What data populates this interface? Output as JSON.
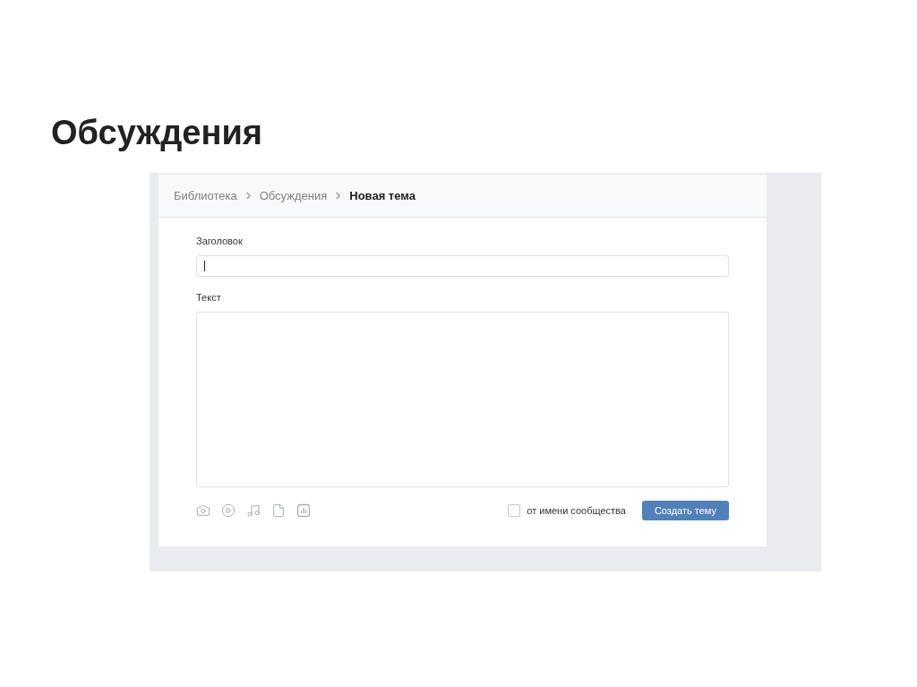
{
  "slide_title": "Обсуждения",
  "breadcrumbs": [
    {
      "label": "Библиотека",
      "selected": false
    },
    {
      "label": "Обсуждения",
      "selected": false
    },
    {
      "label": "Новая тема",
      "selected": true
    }
  ],
  "title_field": {
    "label": "Заголовок"
  },
  "text_field": {
    "label": "Текст"
  },
  "community_checkbox": {
    "label": "от имени сообщества",
    "checked": false
  },
  "submit_button": "Создать тему"
}
